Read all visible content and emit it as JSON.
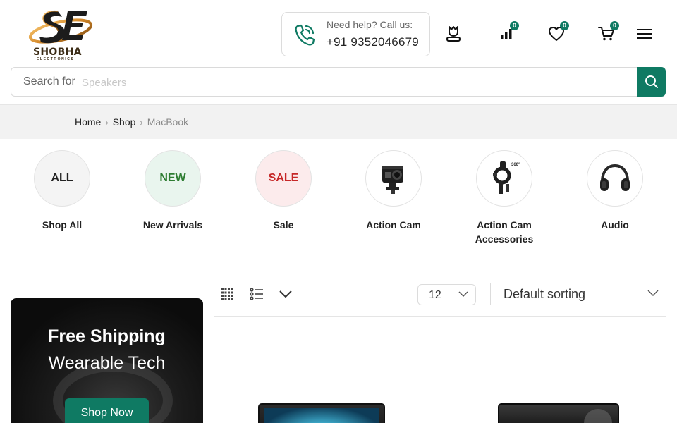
{
  "brand": {
    "name": "SHOBHA",
    "tagline": "ELECTRONICS"
  },
  "help": {
    "label": "Need help? Call us:",
    "phone": "+91 9352046679"
  },
  "header_icons": [
    {
      "name": "account-icon",
      "badge": null
    },
    {
      "name": "compare-icon",
      "badge": "0"
    },
    {
      "name": "wishlist-icon",
      "badge": "0"
    },
    {
      "name": "cart-icon",
      "badge": "0"
    },
    {
      "name": "menu-icon",
      "badge": null
    }
  ],
  "search": {
    "label": "Search for",
    "placeholder": "Speakers"
  },
  "breadcrumb": {
    "home": "Home",
    "shop": "Shop",
    "current": "MacBook"
  },
  "categories": [
    {
      "circle_text": "ALL",
      "label": "Shop All",
      "bg": "#f4f4f4",
      "fg": "#222222"
    },
    {
      "circle_text": "NEW",
      "label": "New Arrivals",
      "bg": "#e9f5ee",
      "fg": "#2e7d32"
    },
    {
      "circle_text": "SALE",
      "label": "Sale",
      "bg": "#fcebec",
      "fg": "#c62828"
    },
    {
      "circle_text": "",
      "label": "Action Cam",
      "icon": "action-camera-icon"
    },
    {
      "circle_text": "",
      "label": "Action Cam Accessories",
      "icon": "camera-mount-icon"
    },
    {
      "circle_text": "",
      "label": "Audio",
      "icon": "headphones-icon"
    }
  ],
  "toolbar": {
    "per_page": "12",
    "sorting": "Default sorting"
  },
  "promo": {
    "title": "Free Shipping",
    "subtitle": "Wearable Tech",
    "button": "Shop Now"
  },
  "colors": {
    "accent": "#0f7a63",
    "badge": "#0f7a63"
  }
}
